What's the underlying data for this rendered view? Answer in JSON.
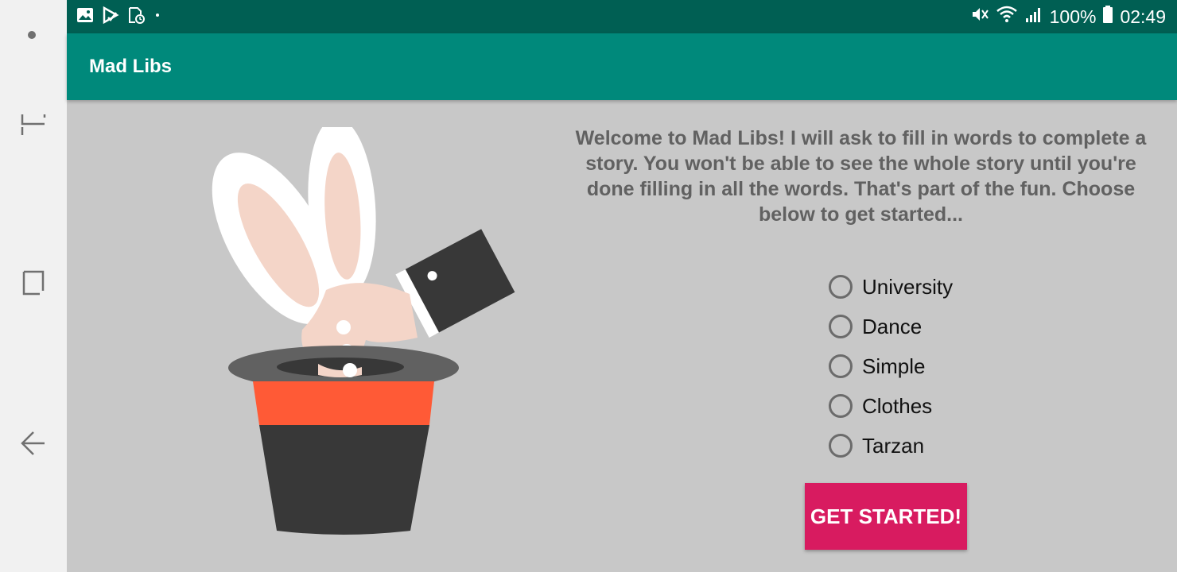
{
  "status_bar": {
    "battery": "100%",
    "time": "02:49",
    "icons": [
      "image-icon",
      "play-store-icon",
      "clock-file-icon",
      "dot-icon",
      "mute-icon",
      "wifi-icon",
      "signal-icon",
      "battery-icon"
    ]
  },
  "app_bar": {
    "title": "Mad Libs"
  },
  "main": {
    "welcome_text": "Welcome to Mad Libs! I will ask to fill in words to complete a story. You won't be able to see the whole story until you're done filling in all the words. That's part of the fun. Choose below to get started...",
    "options": [
      {
        "label": "University"
      },
      {
        "label": "Dance"
      },
      {
        "label": "Simple"
      },
      {
        "label": "Clothes"
      },
      {
        "label": "Tarzan"
      }
    ],
    "button_label": "GET STARTED!"
  },
  "nav_bar": {
    "icons": [
      "home-dot-icon",
      "recents-icon",
      "overview-icon",
      "back-icon"
    ]
  },
  "colors": {
    "status_bar": "#005f53",
    "app_bar": "#00897b",
    "background": "#c8c8c8",
    "button": "#d81b60",
    "hat_band": "#ff5a36",
    "hat": "#383838"
  }
}
